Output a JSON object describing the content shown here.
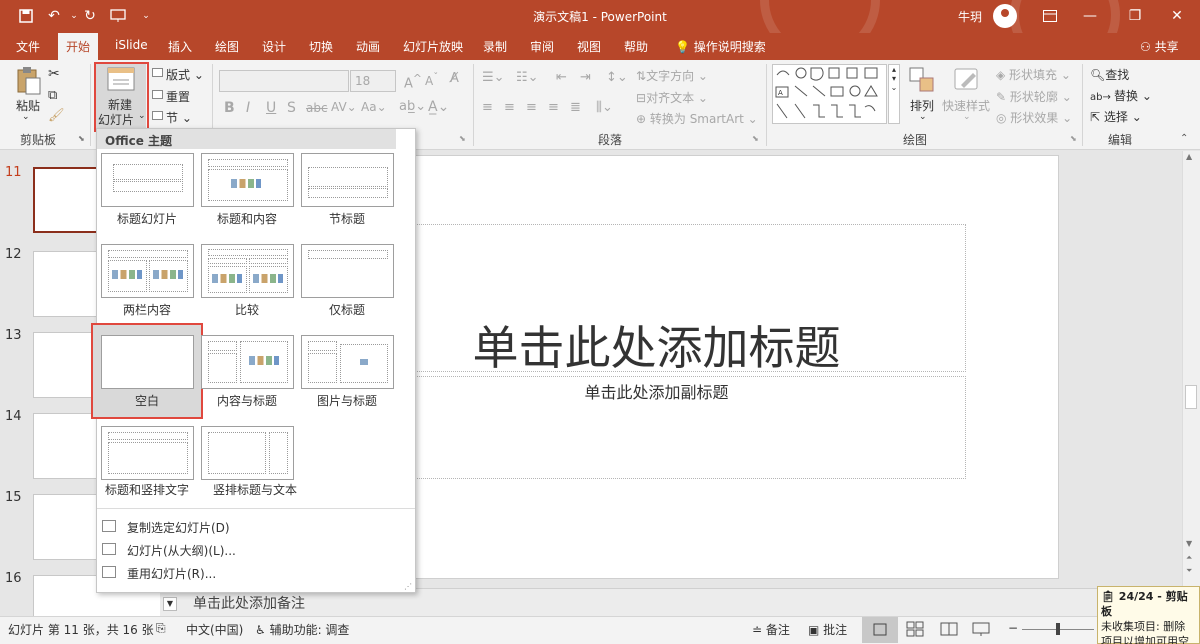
{
  "titlebar": {
    "title": "演示文稿1 - PowerPoint",
    "user": "牛玥"
  },
  "tabs": [
    "文件",
    "开始",
    "iSlide",
    "插入",
    "绘图",
    "设计",
    "切换",
    "动画",
    "幻灯片放映",
    "录制",
    "审阅",
    "视图",
    "帮助"
  ],
  "tellme": "操作说明搜索",
  "share": "共享",
  "ribbon": {
    "paste": "粘贴",
    "new_slide_line1": "新建",
    "new_slide_line2": "幻灯片",
    "layout": "版式",
    "reset": "重置",
    "section": "节",
    "font_size": "18",
    "text_direction": "文字方向",
    "align_text": "对齐文本",
    "smartart": "转换为 SmartArt",
    "arrange": "排列",
    "quick_styles": "快速样式",
    "shape_fill": "形状填充",
    "shape_outline": "形状轮廓",
    "shape_effects": "形状效果",
    "find": "查找",
    "replace": "替换",
    "select": "选择",
    "group_clipboard": "剪贴板",
    "group_paragraph": "段落",
    "group_drawing": "绘图",
    "group_editing": "编辑"
  },
  "thumbs": [
    "11",
    "12",
    "13",
    "14",
    "15",
    "16"
  ],
  "slide": {
    "title_placeholder": "单击此处添加标题",
    "subtitle_placeholder": "单击此处添加副标题"
  },
  "notes_placeholder": "单击此处添加备注",
  "layout_menu": {
    "header": "Office 主题",
    "layouts": [
      "标题幻灯片",
      "标题和内容",
      "节标题",
      "两栏内容",
      "比较",
      "仅标题",
      "空白",
      "内容与标题",
      "图片与标题",
      "标题和竖排文字",
      "竖排标题与文本"
    ],
    "commands": [
      "复制选定幻灯片(D)",
      "幻灯片(从大纲)(L)...",
      "重用幻灯片(R)..."
    ]
  },
  "statusbar": {
    "slide_info": "幻灯片 第 11 张，共 16 张",
    "language": "中文(中国)",
    "accessibility": "辅助功能: 调查",
    "notes": "备注",
    "comments": "批注"
  },
  "clipboard_tip": {
    "title": "24/24 - 剪贴板",
    "body": "未收集项目: 删除项目以增加可用空间"
  },
  "colors": {
    "accent": "#b7472a",
    "highlight_red": "#e0483e"
  }
}
